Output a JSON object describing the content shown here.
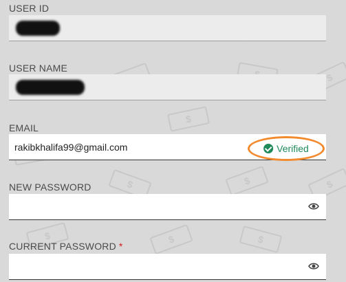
{
  "fields": {
    "user_id": {
      "label": "USER ID",
      "value_redacted": true
    },
    "user_name": {
      "label": "USER NAME",
      "value_redacted": true
    },
    "email": {
      "label": "EMAIL",
      "value": "rakibkhalifa99@gmail.com",
      "status": "Verified",
      "status_icon": "check-circle-icon"
    },
    "new_password": {
      "label": "NEW PASSWORD",
      "value": "",
      "toggle_icon": "eye-icon"
    },
    "current_password": {
      "label": "CURRENT PASSWORD",
      "required_marker": "*",
      "value": "",
      "toggle_icon": "eye-icon"
    }
  },
  "colors": {
    "background": "#d9d9d9",
    "verified": "#1e8a5a",
    "required": "#d21f1f",
    "highlight": "#f28a2e"
  }
}
